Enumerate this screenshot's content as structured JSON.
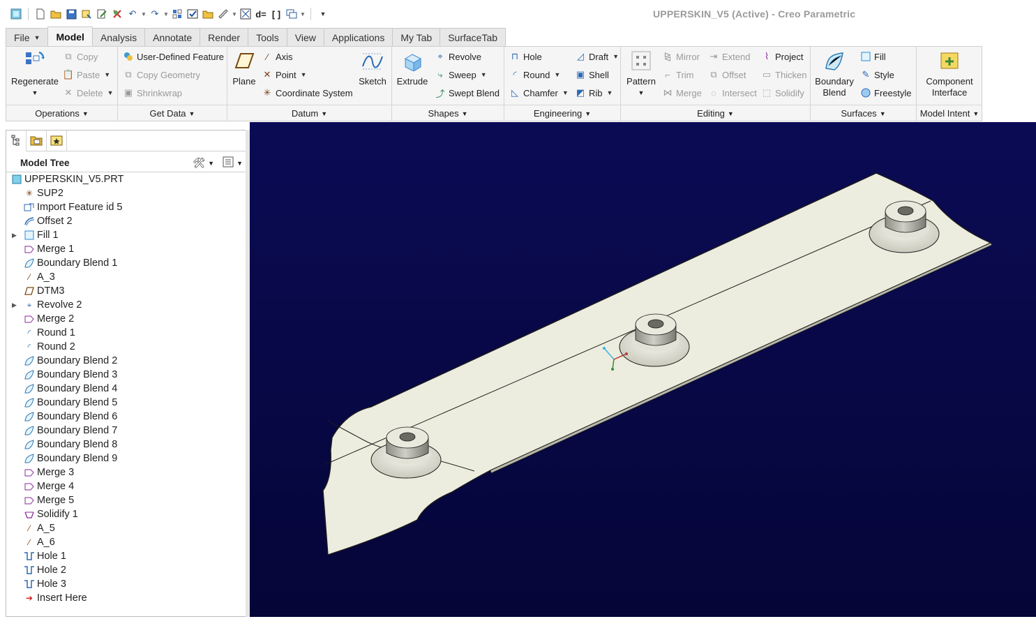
{
  "window": {
    "title": "UPPERSKIN_V5 (Active) - Creo Parametric"
  },
  "qat_icons": [
    "window-icon",
    "new-icon",
    "open-icon",
    "save-icon",
    "regen-icon",
    "edit-icon",
    "erase-icon",
    "undo-icon",
    "redo-icon",
    "regen-manager-icon",
    "verify-icon",
    "folder-icon",
    "measure-icon",
    "param-icon",
    "d-equals-icon",
    "brackets-icon",
    "windows-icon",
    "customize-icon"
  ],
  "tabs": [
    {
      "label": "File"
    },
    {
      "label": "Model"
    },
    {
      "label": "Analysis"
    },
    {
      "label": "Annotate"
    },
    {
      "label": "Render"
    },
    {
      "label": "Tools"
    },
    {
      "label": "View"
    },
    {
      "label": "Applications"
    },
    {
      "label": "My Tab"
    },
    {
      "label": "SurfaceTab"
    }
  ],
  "ribbon": {
    "operations": {
      "title": "Operations",
      "regenerate": "Regenerate",
      "copy": "Copy",
      "paste": "Paste",
      "delete": "Delete"
    },
    "getdata": {
      "title": "Get Data",
      "udf": "User-Defined Feature",
      "copy_geometry": "Copy Geometry",
      "shrinkwrap": "Shrinkwrap"
    },
    "datum": {
      "title": "Datum",
      "plane": "Plane",
      "axis": "Axis",
      "point": "Point",
      "csys": "Coordinate System",
      "sketch": "Sketch"
    },
    "shapes": {
      "title": "Shapes",
      "extrude": "Extrude",
      "revolve": "Revolve",
      "sweep": "Sweep",
      "swept_blend": "Swept Blend"
    },
    "engineering": {
      "title": "Engineering",
      "hole": "Hole",
      "round": "Round",
      "chamfer": "Chamfer",
      "draft": "Draft",
      "shell": "Shell",
      "rib": "Rib"
    },
    "editing": {
      "title": "Editing",
      "pattern": "Pattern",
      "mirror": "Mirror",
      "trim": "Trim",
      "merge": "Merge",
      "extend": "Extend",
      "offset": "Offset",
      "intersect": "Intersect",
      "project": "Project",
      "thicken": "Thicken",
      "solidify": "Solidify"
    },
    "surfaces": {
      "title": "Surfaces",
      "boundary_line1": "Boundary",
      "boundary_line2": "Blend",
      "fill": "Fill",
      "style": "Style",
      "freestyle": "Freestyle"
    },
    "intent": {
      "title": "Model Intent",
      "ci_line1": "Component",
      "ci_line2": "Interface"
    }
  },
  "model_tree": {
    "header": "Model Tree",
    "items": [
      {
        "label": "UPPERSKIN_V5.PRT",
        "icon": "part-icon",
        "level": 0,
        "expand": false
      },
      {
        "label": "SUP2",
        "icon": "csys-icon",
        "level": 1,
        "expand": false
      },
      {
        "label": "Import Feature id 5",
        "icon": "import-icon",
        "level": 1,
        "expand": false
      },
      {
        "label": "Offset 2",
        "icon": "offset-icon",
        "level": 1,
        "expand": false
      },
      {
        "label": "Fill 1",
        "icon": "fill-icon",
        "level": 1,
        "expand": true
      },
      {
        "label": "Merge 1",
        "icon": "merge-icon",
        "level": 1,
        "expand": false
      },
      {
        "label": "Boundary Blend 1",
        "icon": "boundary-blend-icon",
        "level": 1,
        "expand": false
      },
      {
        "label": "A_3",
        "icon": "axis-icon",
        "level": 1,
        "expand": false
      },
      {
        "label": "DTM3",
        "icon": "datum-plane-icon",
        "level": 1,
        "expand": false
      },
      {
        "label": "Revolve 2",
        "icon": "revolve-icon",
        "level": 1,
        "expand": true
      },
      {
        "label": "Merge 2",
        "icon": "merge-icon",
        "level": 1,
        "expand": false
      },
      {
        "label": "Round 1",
        "icon": "round-icon",
        "level": 1,
        "expand": false
      },
      {
        "label": "Round 2",
        "icon": "round-icon",
        "level": 1,
        "expand": false
      },
      {
        "label": "Boundary Blend 2",
        "icon": "boundary-blend-icon",
        "level": 1,
        "expand": false
      },
      {
        "label": "Boundary Blend 3",
        "icon": "boundary-blend-icon",
        "level": 1,
        "expand": false
      },
      {
        "label": "Boundary Blend 4",
        "icon": "boundary-blend-icon",
        "level": 1,
        "expand": false
      },
      {
        "label": "Boundary Blend 5",
        "icon": "boundary-blend-icon",
        "level": 1,
        "expand": false
      },
      {
        "label": "Boundary Blend 6",
        "icon": "boundary-blend-icon",
        "level": 1,
        "expand": false
      },
      {
        "label": "Boundary Blend 7",
        "icon": "boundary-blend-icon",
        "level": 1,
        "expand": false
      },
      {
        "label": "Boundary Blend 8",
        "icon": "boundary-blend-icon",
        "level": 1,
        "expand": false
      },
      {
        "label": "Boundary Blend 9",
        "icon": "boundary-blend-icon",
        "level": 1,
        "expand": false
      },
      {
        "label": "Merge 3",
        "icon": "merge-icon",
        "level": 1,
        "expand": false
      },
      {
        "label": "Merge 4",
        "icon": "merge-icon",
        "level": 1,
        "expand": false
      },
      {
        "label": "Merge 5",
        "icon": "merge-icon",
        "level": 1,
        "expand": false
      },
      {
        "label": "Solidify 1",
        "icon": "solidify-icon",
        "level": 1,
        "expand": false
      },
      {
        "label": "A_5",
        "icon": "axis-icon",
        "level": 1,
        "expand": false
      },
      {
        "label": "A_6",
        "icon": "axis-icon",
        "level": 1,
        "expand": false
      },
      {
        "label": "Hole 1",
        "icon": "hole-icon",
        "level": 1,
        "expand": false
      },
      {
        "label": "Hole 2",
        "icon": "hole-icon",
        "level": 1,
        "expand": false
      },
      {
        "label": "Hole 3",
        "icon": "hole-icon",
        "level": 1,
        "expand": false
      },
      {
        "label": "Insert Here",
        "icon": "insert-arrow-icon",
        "level": 1,
        "expand": false
      }
    ]
  },
  "colors": {
    "viewport": "#07074a",
    "part": "#ededdf",
    "accent": "#2d5e9a"
  }
}
